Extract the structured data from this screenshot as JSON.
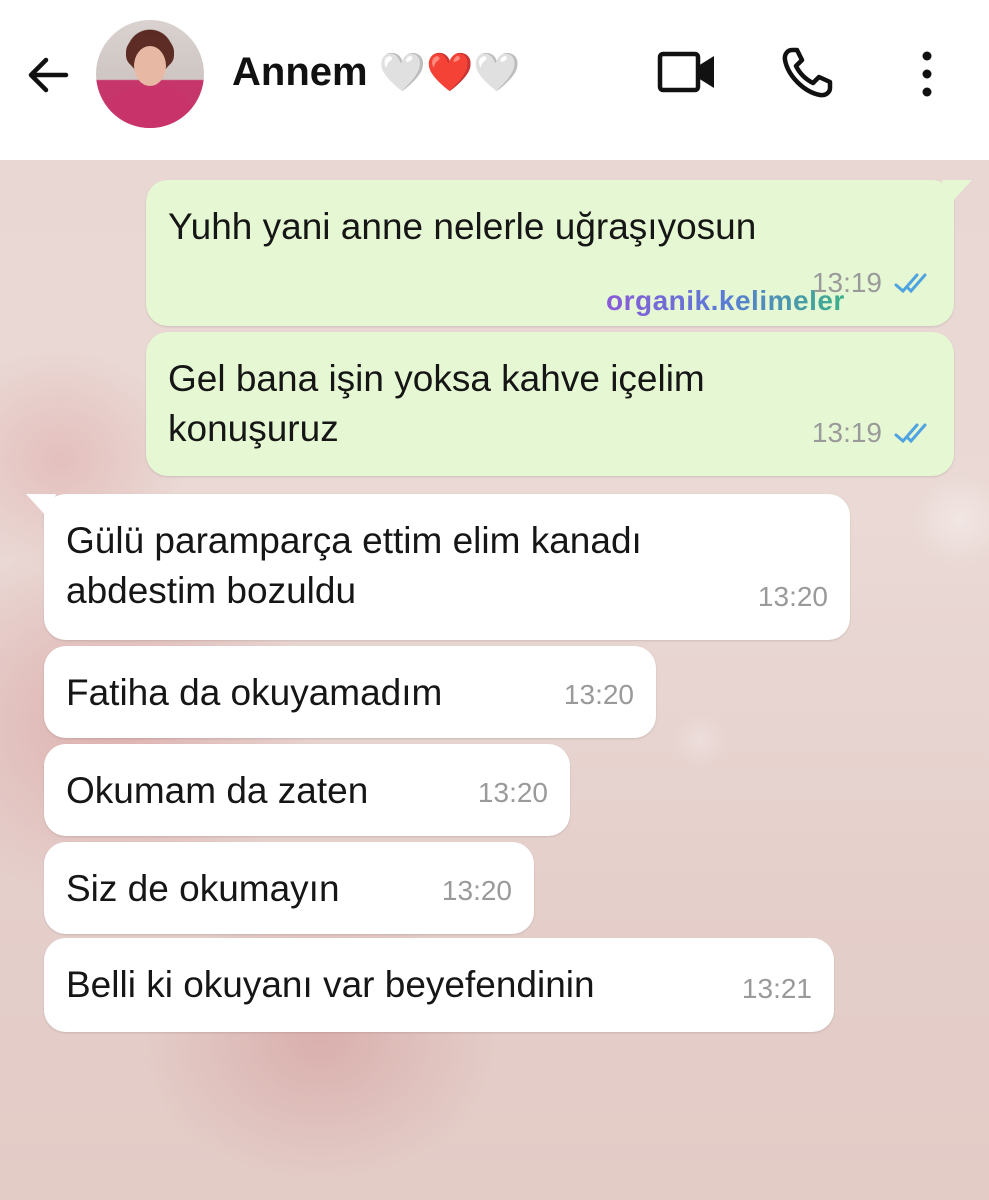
{
  "header": {
    "contact_name": "Annem",
    "contact_emoji": "🤍❤️🤍"
  },
  "messages": [
    {
      "direction": "out",
      "text": "Yuhh yani anne nelerle uğraşıyosun",
      "time": "13:19",
      "status": "read"
    },
    {
      "direction": "out",
      "text": "Gel bana işin yoksa kahve içelim\nkonuşuruz",
      "time": "13:19",
      "status": "read"
    },
    {
      "direction": "in",
      "text": "Gülü paramparça ettim elim kanadı\nabdestim bozuldu",
      "time": "13:20"
    },
    {
      "direction": "in",
      "text": "Fatiha da okuyamadım",
      "time": "13:20"
    },
    {
      "direction": "in",
      "text": "Okumam da zaten",
      "time": "13:20"
    },
    {
      "direction": "in",
      "text": "Siz de okumayın",
      "time": "13:20"
    },
    {
      "direction": "in",
      "text": "Belli ki okuyanı var beyefendinin",
      "time": "13:21"
    }
  ],
  "watermark": "organik.kelimeler",
  "colors": {
    "outgoing_bubble": "#e6f8d3",
    "incoming_bubble": "#ffffff",
    "read_ticks": "#4fa3e0"
  }
}
